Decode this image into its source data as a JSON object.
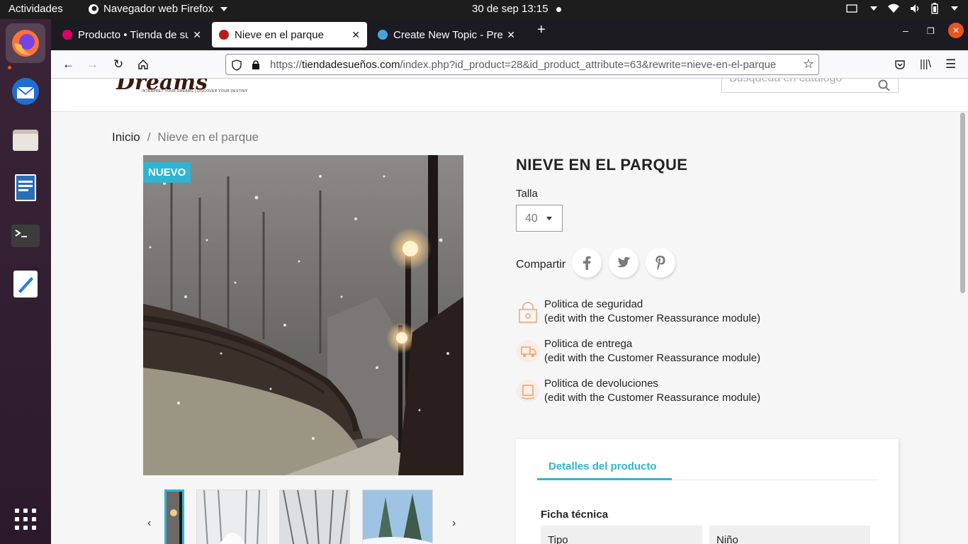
{
  "topbar": {
    "activities": "Actividades",
    "app_name": "Navegador web Firefox",
    "clock": "30 de sep  13:15"
  },
  "dock": {
    "items": [
      "firefox-icon",
      "thunderbird-icon",
      "files-icon",
      "writer-icon",
      "terminal-icon",
      "text-editor-icon",
      "app-grid-icon"
    ]
  },
  "browser": {
    "tabs": [
      {
        "label": "Producto • Tienda de sueños",
        "icon": "prestashop-icon"
      },
      {
        "label": "Nieve en el parque",
        "icon": "site-favicon"
      },
      {
        "label": "Create New Topic - PrestaShop Forums",
        "icon": "prestashop-forum-icon"
      }
    ],
    "url_host_prefix": "https://",
    "url_host": "tiendadesueños.com",
    "url_rest": "/index.php?id_product=28&id_product_attribute=63&rewrite=nieve-en-el-parque"
  },
  "site": {
    "logo": "Dreams",
    "logo_tagline": "INTERPRET YOUR DREAMS | DISCOVER YOUR DESTINY",
    "search_placeholder": "Búsqueda en catálogo"
  },
  "breadcrumb": {
    "home": "Inicio",
    "separator": "/",
    "current": "Nieve en el parque"
  },
  "product": {
    "badge": "NUEVO",
    "title": "NIEVE EN EL PARQUE",
    "size_label": "Talla",
    "size_value": "40",
    "share_label": "Compartir",
    "share": [
      "facebook-icon",
      "twitter-icon",
      "pinterest-icon"
    ]
  },
  "reassurance": [
    {
      "title": "Politica de seguridad",
      "text": "(edit with the Customer Reassurance module)",
      "icon": "lock-icon"
    },
    {
      "title": "Politica de entrega",
      "text": "(edit with the Customer Reassurance module)",
      "icon": "truck-icon"
    },
    {
      "title": "Politica de devoluciones",
      "text": "(edit with the Customer Reassurance module)",
      "icon": "return-box-icon"
    }
  ],
  "details": {
    "tab": "Detalles del producto",
    "ficha": "Ficha técnica",
    "row": [
      "Tipo",
      "Niño"
    ]
  },
  "colors": {
    "accent": "#2fb5d2",
    "firefox_tabbar": "#1c1b22",
    "dock": "#2c1a2c"
  }
}
